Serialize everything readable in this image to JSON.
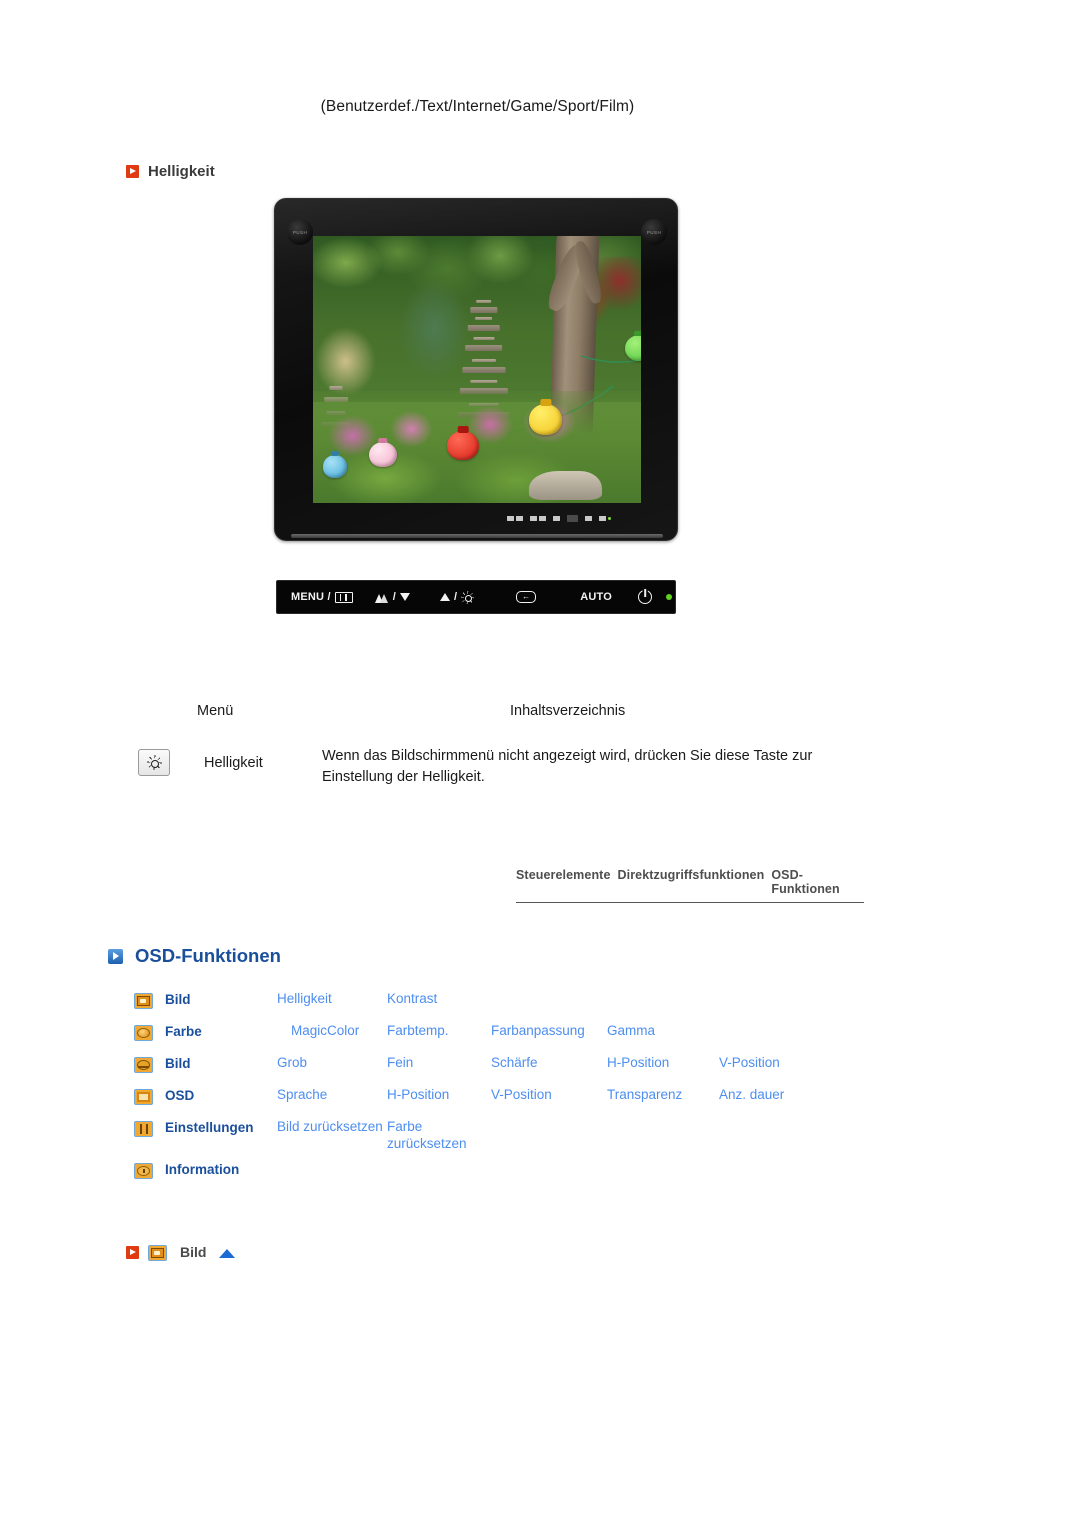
{
  "page": {
    "mode_caption": "(Benutzerdef./Text/Internet/Game/Sport/Film)",
    "section_heading": "Helligkeit"
  },
  "monitor": {
    "push_left": "PUSH",
    "push_right": "PUSH",
    "screen_alt": "Garten mit Steinpagode und bunten Lampions"
  },
  "button_bar": {
    "menu_label": "MENU /",
    "magic_label": "/",
    "bright_label": "/",
    "auto_label": "AUTO",
    "icons": {
      "menu": "menu-grid-icon",
      "magiccolor": "magiccolor-icon",
      "down": "arrow-down-icon",
      "up": "arrow-up-icon",
      "brightness": "sun-icon",
      "enter": "enter-icon",
      "power": "power-icon",
      "led": "power-led"
    }
  },
  "menu_table": {
    "header_menu": "Menü",
    "header_toc": "Inhaltsverzeichnis",
    "row": {
      "icon": "brightness-sun-icon",
      "name": "Helligkeit",
      "description": "Wenn das Bildschirmmenü nicht angezeigt wird, drücken Sie diese Taste zur Einstellung der Helligkeit."
    }
  },
  "nav": {
    "items": [
      "Steuerelemente",
      "Direktzugriffsfunktionen",
      "OSD-Funktionen"
    ]
  },
  "osd": {
    "heading": "OSD-Funktionen",
    "rows": [
      {
        "icon": "picture-icon",
        "category": "Bild",
        "items": [
          "Helligkeit",
          "Kontrast"
        ]
      },
      {
        "icon": "color-icon",
        "category": "Farbe",
        "items": [
          "MagicColor",
          "Farbtemp.",
          "Farbanpassung",
          "Gamma"
        ]
      },
      {
        "icon": "image-icon",
        "category": "Bild",
        "items": [
          "Grob",
          "Fein",
          "Schärfe",
          "H-Position",
          "V-Position"
        ]
      },
      {
        "icon": "osd-icon",
        "category": "OSD",
        "items": [
          "Sprache",
          "H-Position",
          "V-Position",
          "Transparenz",
          "Anz. dauer"
        ]
      },
      {
        "icon": "settings-icon",
        "category": "Einstellungen",
        "items": [
          "Bild zurücksetzen",
          "Farbe zurücksetzen"
        ]
      },
      {
        "icon": "information-icon",
        "category": "Information",
        "items": []
      }
    ]
  },
  "footer": {
    "icon": "picture-icon",
    "label": "Bild",
    "up_marker": "scroll-up-triangle"
  },
  "colors": {
    "accent_red": "#E03A10",
    "accent_blue_head": "#1a4f9c",
    "link_blue": "#4d8ef0",
    "nav_gray": "#4e4e4e",
    "icon_orange": "#f0a830"
  }
}
